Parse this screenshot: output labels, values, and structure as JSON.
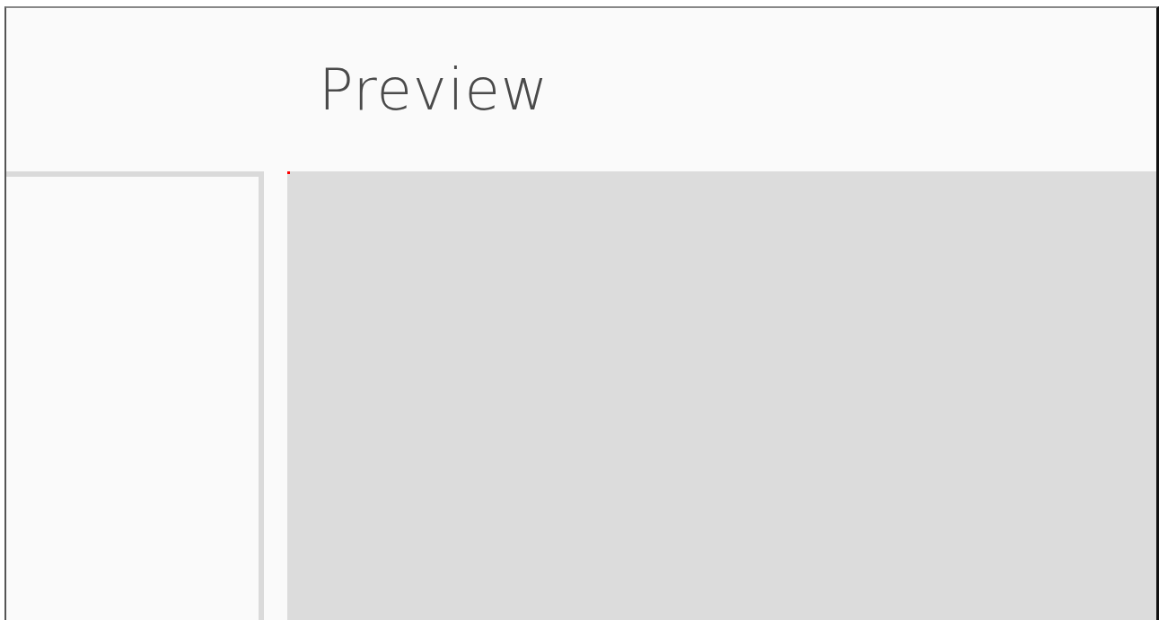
{
  "header": {
    "title": "Preview"
  }
}
